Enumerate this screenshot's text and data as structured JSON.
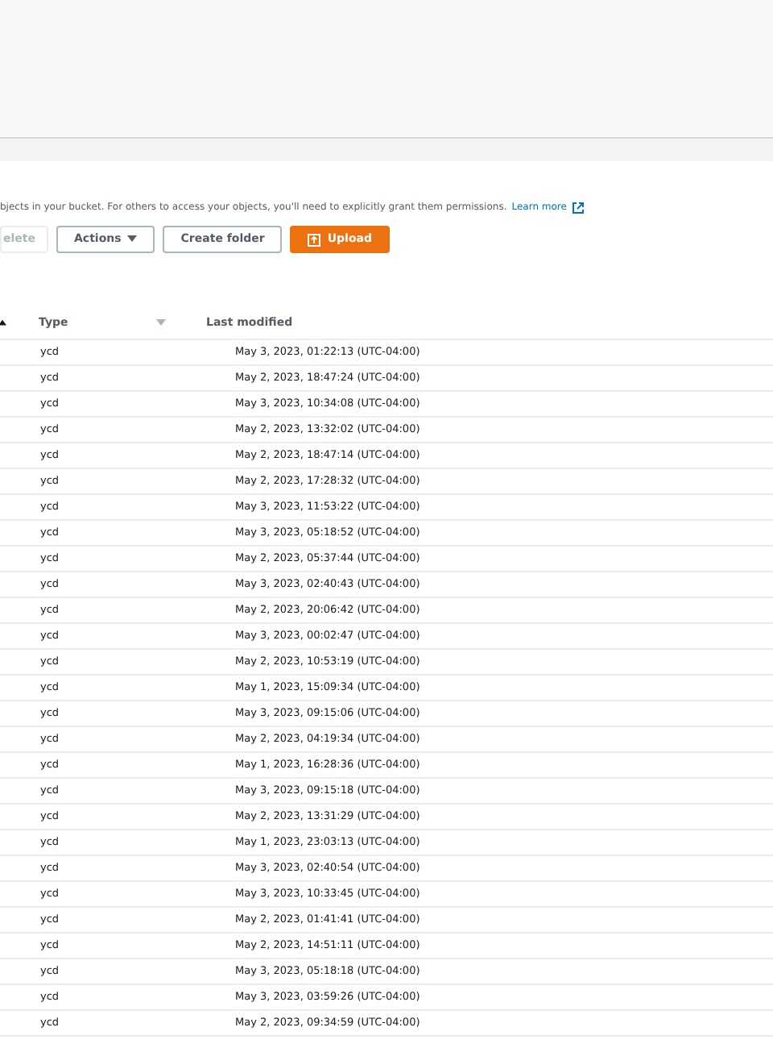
{
  "info": {
    "text": "bjects in your bucket. For others to access your objects, you'll need to explicitly grant them permissions.",
    "link": "Learn more"
  },
  "buttons": [
    {
      "kind": "plain",
      "label": "elete",
      "disabled": true
    },
    {
      "kind": "dropdown",
      "label": "Actions",
      "disabled": false
    },
    {
      "kind": "plain",
      "label": "Create folder",
      "disabled": false
    },
    {
      "kind": "primary",
      "label": "Upload",
      "disabled": false
    }
  ],
  "table": {
    "columns": [
      {
        "label": "Type"
      },
      {
        "label": "Last modified"
      }
    ],
    "rows": [
      {
        "type": "ycd",
        "modified": "May 3, 2023, 01:22:13 (UTC-04:00)"
      },
      {
        "type": "ycd",
        "modified": "May 2, 2023, 18:47:24 (UTC-04:00)"
      },
      {
        "type": "ycd",
        "modified": "May 3, 2023, 10:34:08 (UTC-04:00)"
      },
      {
        "type": "ycd",
        "modified": "May 2, 2023, 13:32:02 (UTC-04:00)"
      },
      {
        "type": "ycd",
        "modified": "May 2, 2023, 18:47:14 (UTC-04:00)"
      },
      {
        "type": "ycd",
        "modified": "May 2, 2023, 17:28:32 (UTC-04:00)"
      },
      {
        "type": "ycd",
        "modified": "May 3, 2023, 11:53:22 (UTC-04:00)"
      },
      {
        "type": "ycd",
        "modified": "May 3, 2023, 05:18:52 (UTC-04:00)"
      },
      {
        "type": "ycd",
        "modified": "May 2, 2023, 05:37:44 (UTC-04:00)"
      },
      {
        "type": "ycd",
        "modified": "May 3, 2023, 02:40:43 (UTC-04:00)"
      },
      {
        "type": "ycd",
        "modified": "May 2, 2023, 20:06:42 (UTC-04:00)"
      },
      {
        "type": "ycd",
        "modified": "May 3, 2023, 00:02:47 (UTC-04:00)"
      },
      {
        "type": "ycd",
        "modified": "May 2, 2023, 10:53:19 (UTC-04:00)"
      },
      {
        "type": "ycd",
        "modified": "May 1, 2023, 15:09:34 (UTC-04:00)"
      },
      {
        "type": "ycd",
        "modified": "May 3, 2023, 09:15:06 (UTC-04:00)"
      },
      {
        "type": "ycd",
        "modified": "May 2, 2023, 04:19:34 (UTC-04:00)"
      },
      {
        "type": "ycd",
        "modified": "May 1, 2023, 16:28:36 (UTC-04:00)"
      },
      {
        "type": "ycd",
        "modified": "May 3, 2023, 09:15:18 (UTC-04:00)"
      },
      {
        "type": "ycd",
        "modified": "May 2, 2023, 13:31:29 (UTC-04:00)"
      },
      {
        "type": "ycd",
        "modified": "May 1, 2023, 23:03:13 (UTC-04:00)"
      },
      {
        "type": "ycd",
        "modified": "May 3, 2023, 02:40:54 (UTC-04:00)"
      },
      {
        "type": "ycd",
        "modified": "May 3, 2023, 10:33:45 (UTC-04:00)"
      },
      {
        "type": "ycd",
        "modified": "May 2, 2023, 01:41:41 (UTC-04:00)"
      },
      {
        "type": "ycd",
        "modified": "May 2, 2023, 14:51:11 (UTC-04:00)"
      },
      {
        "type": "ycd",
        "modified": "May 3, 2023, 05:18:18 (UTC-04:00)"
      },
      {
        "type": "ycd",
        "modified": "May 3, 2023, 03:59:26 (UTC-04:00)"
      },
      {
        "type": "ycd",
        "modified": "May 2, 2023, 09:34:59 (UTC-04:00)"
      }
    ]
  }
}
